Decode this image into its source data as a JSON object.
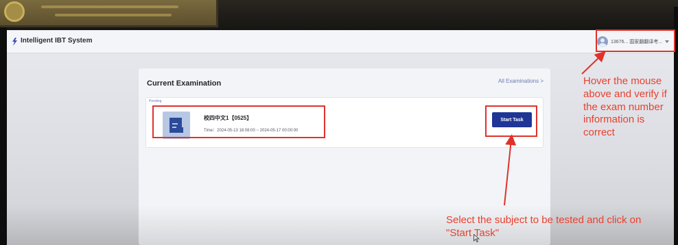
{
  "app": {
    "title": "Intelligent IBT System"
  },
  "user": {
    "label": "13676... 国家翻翻译考...",
    "menu_icon": "chevron-down-icon"
  },
  "exam_panel": {
    "title": "Current Examination",
    "all_link": "All Examinations >",
    "status": "Pending",
    "exam": {
      "name": "校四中文1【0525】",
      "time": "Time：2024-05-13 18:08:00 ~ 2024-05-17 00:00:00",
      "icon": "document-icon"
    },
    "start_button": "Start Task"
  },
  "annotations": {
    "user_hint": "Hover the mouse above and verify if the exam number information is correct",
    "user_hint_lines": [
      "Hover the mouse",
      "above and verify if",
      "the exam number",
      "information is",
      "correct"
    ],
    "start_hint_lines": [
      "Select the subject to be tested and click on",
      "\"Start Task\""
    ]
  },
  "colors": {
    "accent": "#1e3596",
    "annotation": "#e0312b",
    "link": "#6c7bb0"
  }
}
